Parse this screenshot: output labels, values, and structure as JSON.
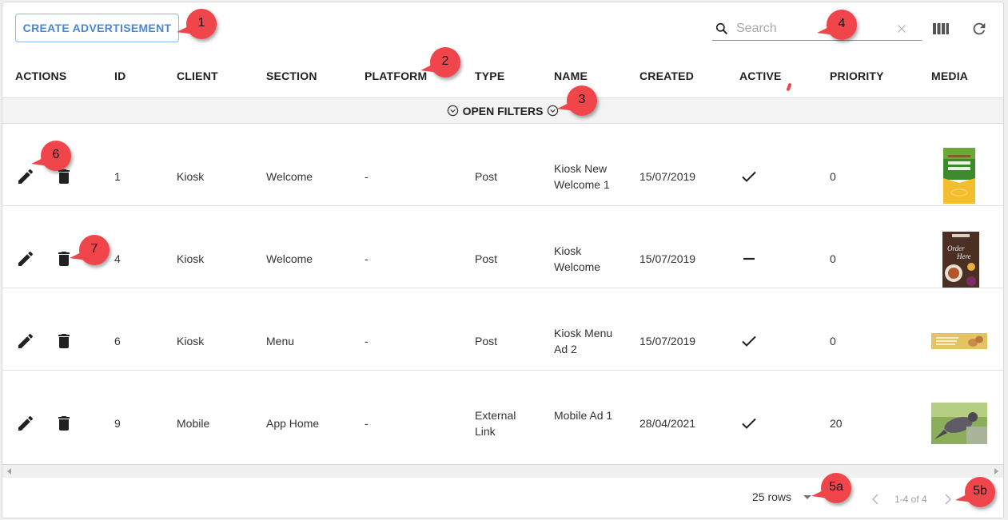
{
  "toolbar": {
    "create_label": "CREATE ADVERTISEMENT",
    "search_placeholder": "Search",
    "search_value": "",
    "icons": {
      "search": "search-icon",
      "clear": "close-icon",
      "columns": "view-column-icon",
      "refresh": "refresh-icon"
    }
  },
  "table": {
    "columns": [
      "ACTIONS",
      "ID",
      "CLIENT",
      "SECTION",
      "PLATFORM",
      "TYPE",
      "NAME",
      "CREATED",
      "ACTIVE",
      "PRIORITY",
      "MEDIA"
    ],
    "filters_label": "OPEN FILTERS",
    "rows": [
      {
        "id": "1",
        "client": "Kiosk",
        "section": "Welcome",
        "platform": "-",
        "type": "Post",
        "name": "Kiosk New Welcome 1",
        "created": "15/07/2019",
        "active": "check",
        "priority": "0",
        "media": "kiosk-self-serve-order-pay-here-poster"
      },
      {
        "id": "4",
        "client": "Kiosk",
        "section": "Welcome",
        "platform": "-",
        "type": "Post",
        "name": "Kiosk Welcome",
        "created": "15/07/2019",
        "active": "dash",
        "priority": "0",
        "media": "order-here-food-poster"
      },
      {
        "id": "6",
        "client": "Kiosk",
        "section": "Menu",
        "platform": "-",
        "type": "Post",
        "name": "Kiosk Menu Ad 2",
        "created": "15/07/2019",
        "active": "check",
        "priority": "0",
        "media": "eggs-banner"
      },
      {
        "id": "9",
        "client": "Mobile",
        "section": "App Home",
        "platform": "-",
        "type": "External Link",
        "name": "Mobile Ad 1",
        "created": "28/04/2021",
        "active": "check",
        "priority": "20",
        "media": "bird-photo"
      }
    ]
  },
  "pagination": {
    "rows_per_page": "25 rows",
    "range_label": "1-4 of 4"
  },
  "callouts": [
    "1",
    "2",
    "3",
    "4",
    "5a",
    "5b",
    "6",
    "7"
  ],
  "colors": {
    "accent": "#4a86d6",
    "callout": "#f0454b",
    "filters_bar": "#f3f3f3"
  }
}
